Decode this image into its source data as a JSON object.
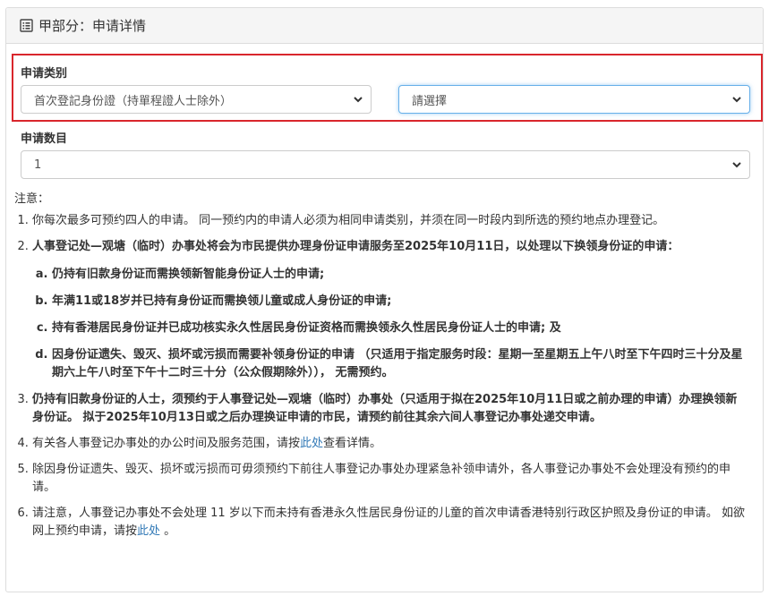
{
  "header": {
    "title": "甲部分：申请详情",
    "icon": "list-alt-icon"
  },
  "form": {
    "application_type_label": "申请类别",
    "application_type_select_1": "首次登記身份證（持單程證人士除外）",
    "application_type_select_2": "請選擇",
    "application_count_label": "申请数目",
    "application_count_select": "1"
  },
  "notes": {
    "title": "注意：",
    "n1": "你每次最多可预约四人的申请。 同一预约内的申请人必须为相同申请类别，并须在同一时段内到所选的预约地点办理登记。",
    "n2": "人事登记处—观塘（临时）办事处将会为市民提供办理身份证申请服务至2025年10月11日，以处理以下换领身份证的申请：",
    "n2a": "仍持有旧款身份证而需换领新智能身份证人士的申请;",
    "n2b": "年满11或18岁并已持有身份证而需换领儿童或成人身份证的申请;",
    "n2c": "持有香港居民身份证并已成功核实永久性居民身份证资格而需换领永久性居民身份证人士的申请; 及",
    "n2d": "因身份证遗失、毁灭、损坏或污损而需要补领身份证的申请 （只适用于指定服务时段：星期一至星期五上午八时至下午四时三十分及星期六上午八时至下午十二时三十分（公众假期除外））， 无需预约。",
    "n3": "仍持有旧款身份证的人士，须预约于人事登记处—观塘（临时）办事处（只适用于拟在2025年10月11日或之前办理的申请）办理换领新身份证。 拟于2025年10月13日或之后办理换证申请的市民，请预约前往其余六间人事登记办事处递交申请。",
    "n4_before": "有关各人事登记办事处的办公时间及服务范围，请按",
    "n4_link": "此处",
    "n4_after": "查看详情。",
    "n5": "除因身份证遗失、毁灭、损坏或污损而可毋须预约下前往人事登记办事处办理紧急补领申请外，各人事登记办事处不会处理没有预约的申请。",
    "n6_before": "请注意，人事登记办事处不会处理 11 岁以下而未持有香港永久性居民身份证的儿童的首次申请香港特别行政区护照及身份证的申请。 如欲网上预约申请，请按",
    "n6_link": "此处",
    "n6_after": " 。"
  }
}
